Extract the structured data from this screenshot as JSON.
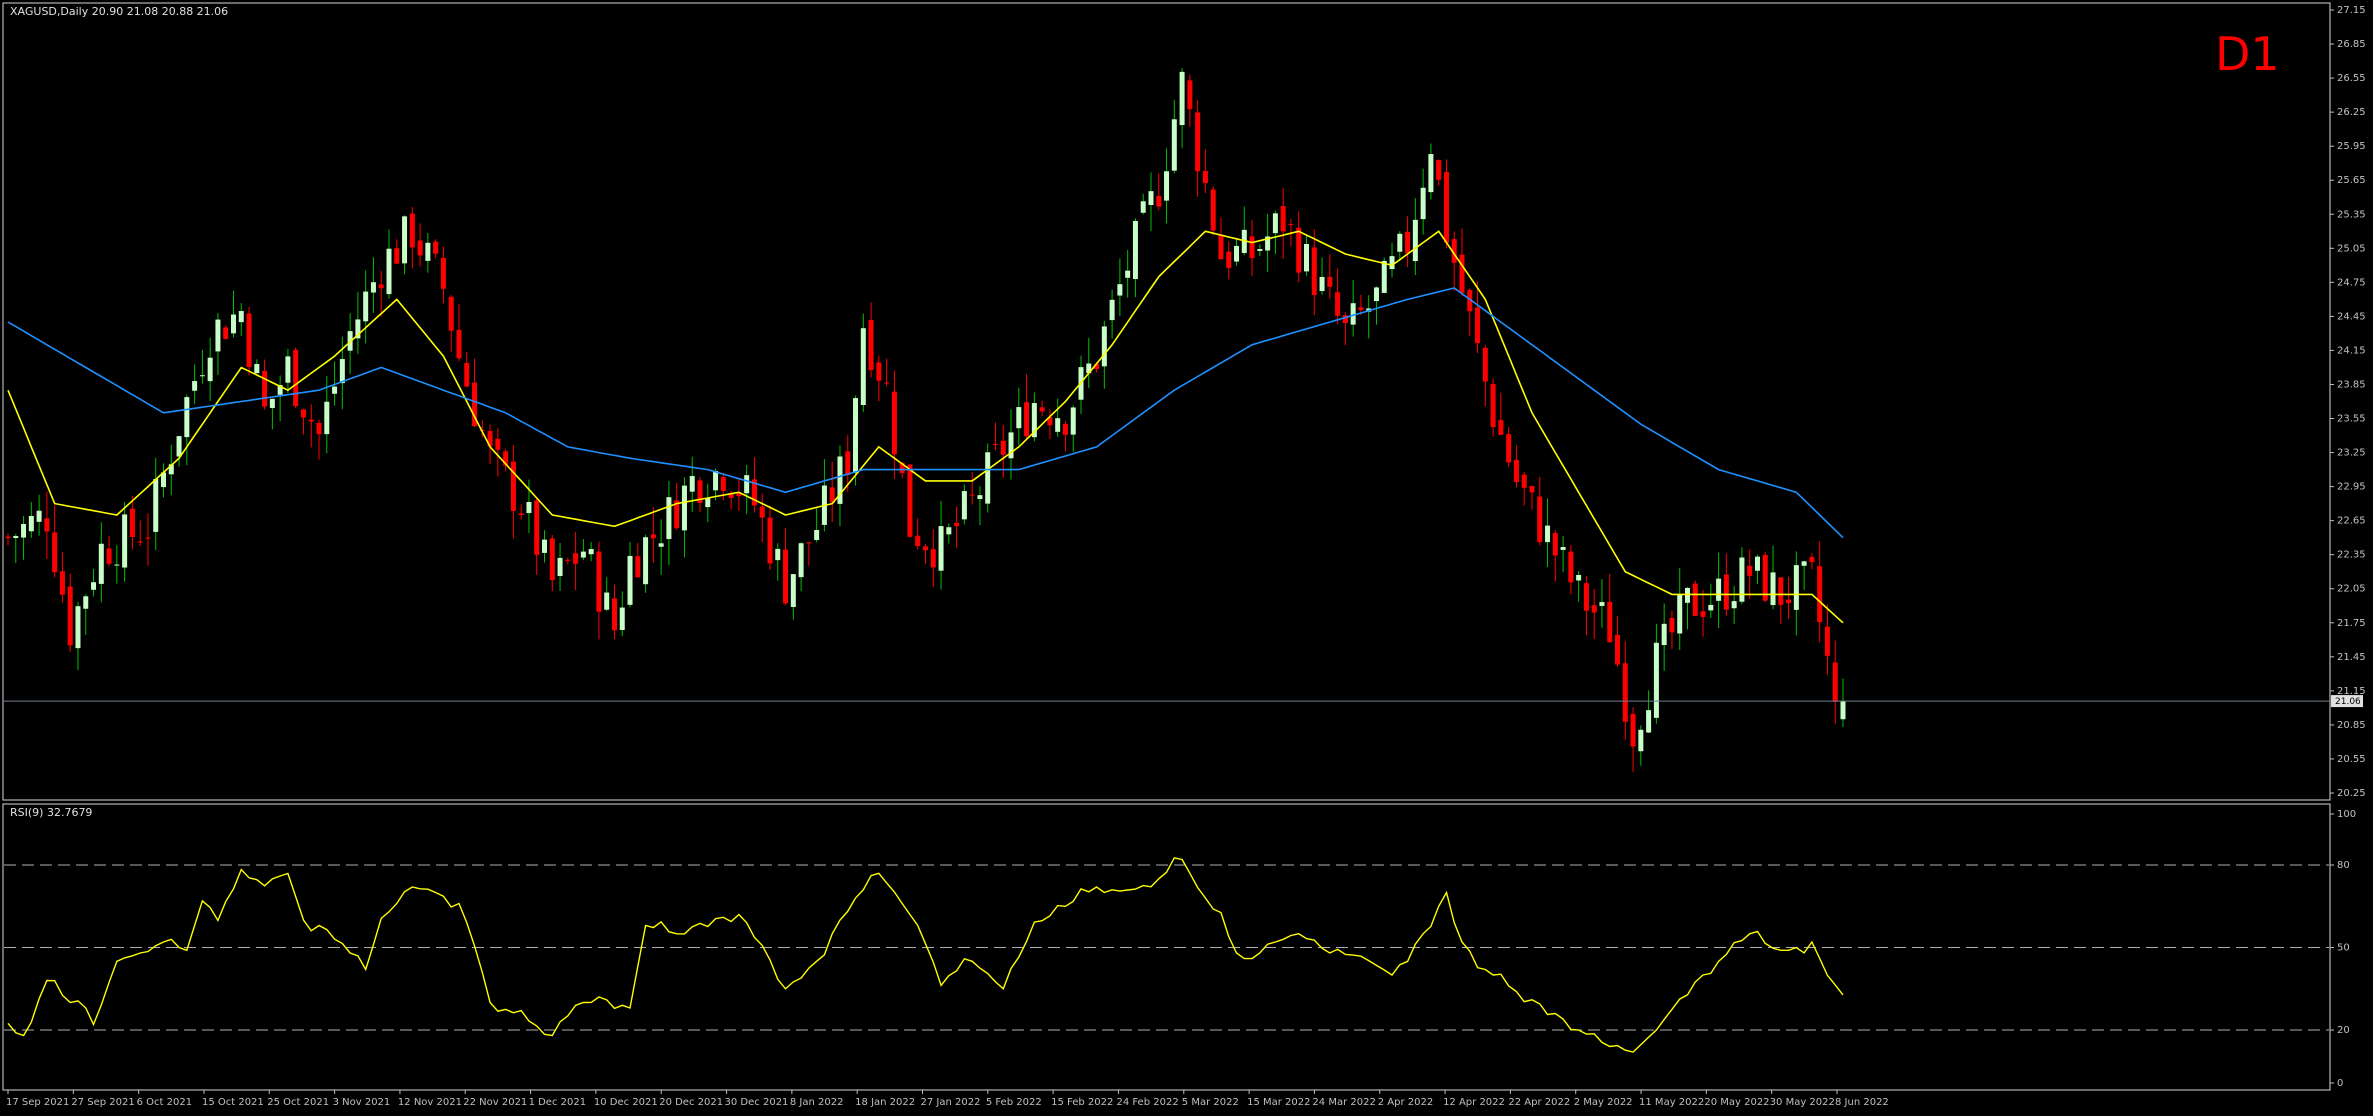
{
  "header": {
    "symbol_line": "XAGUSD,Daily  20.90 21.08 20.88 21.06",
    "timeframe_badge": "D1",
    "current_price": "21.06"
  },
  "rsi_panel": {
    "label": "RSI(9) 32.7679"
  },
  "colors": {
    "background": "#000000",
    "bull_candle": "#c8ffc8",
    "bear_candle": "#ff0000",
    "wick_bull": "#00c000",
    "wick_bear": "#ff0000",
    "ma_fast": "#ffff00",
    "ma_slow": "#1e90ff",
    "rsi_line": "#ffff00",
    "price_line": "#708090",
    "grid_text": "#c0c0c0"
  },
  "chart_data": [
    {
      "type": "candlestick",
      "title": "XAGUSD,Daily",
      "ylim": [
        20.25,
        27.15
      ],
      "y_ticks": [
        "27.15",
        "26.85",
        "26.55",
        "26.25",
        "25.95",
        "25.65",
        "25.35",
        "25.05",
        "24.75",
        "24.45",
        "24.15",
        "23.85",
        "23.55",
        "23.25",
        "22.95",
        "22.65",
        "22.35",
        "22.05",
        "21.75",
        "21.45",
        "21.15",
        "20.85",
        "20.55",
        "20.25"
      ],
      "x_ticks": [
        "17 Sep 2021",
        "27 Sep 2021",
        "6 Oct 2021",
        "15 Oct 2021",
        "25 Oct 2021",
        "3 Nov 2021",
        "12 Nov 2021",
        "22 Nov 2021",
        "1 Dec 2021",
        "10 Dec 2021",
        "20 Dec 2021",
        "30 Dec 2021",
        "8 Jan 2022",
        "18 Jan 2022",
        "27 Jan 2022",
        "5 Feb 2022",
        "15 Feb 2022",
        "24 Feb 2022",
        "5 Mar 2022",
        "15 Mar 2022",
        "24 Mar 2022",
        "2 Apr 2022",
        "12 Apr 2022",
        "22 Apr 2022",
        "2 May 2022",
        "11 May 2022",
        "20 May 2022",
        "30 May 2022",
        "8 Jun 2022"
      ],
      "anchors": [
        [
          0,
          22.5
        ],
        [
          5,
          22.7
        ],
        [
          8,
          21.7
        ],
        [
          12,
          22.4
        ],
        [
          18,
          22.6
        ],
        [
          22,
          23.5
        ],
        [
          26,
          24.3
        ],
        [
          30,
          24.5
        ],
        [
          33,
          23.6
        ],
        [
          36,
          24.0
        ],
        [
          40,
          23.4
        ],
        [
          44,
          24.3
        ],
        [
          48,
          24.9
        ],
        [
          52,
          25.2
        ],
        [
          56,
          24.7
        ],
        [
          58,
          24.1
        ],
        [
          62,
          23.2
        ],
        [
          66,
          22.8
        ],
        [
          70,
          22.1
        ],
        [
          74,
          22.4
        ],
        [
          78,
          21.7
        ],
        [
          80,
          22.3
        ],
        [
          84,
          22.6
        ],
        [
          88,
          23.0
        ],
        [
          92,
          23.1
        ],
        [
          96,
          22.8
        ],
        [
          100,
          22.1
        ],
        [
          104,
          22.6
        ],
        [
          108,
          23.2
        ],
        [
          110,
          24.4
        ],
        [
          113,
          23.8
        ],
        [
          116,
          22.6
        ],
        [
          120,
          22.4
        ],
        [
          124,
          22.8
        ],
        [
          128,
          23.3
        ],
        [
          132,
          23.7
        ],
        [
          136,
          23.6
        ],
        [
          140,
          24.1
        ],
        [
          144,
          24.9
        ],
        [
          148,
          25.6
        ],
        [
          151,
          26.5
        ],
        [
          153,
          25.9
        ],
        [
          156,
          25.0
        ],
        [
          160,
          25.0
        ],
        [
          164,
          25.3
        ],
        [
          168,
          24.8
        ],
        [
          172,
          24.3
        ],
        [
          176,
          24.6
        ],
        [
          180,
          25.1
        ],
        [
          183,
          26.0
        ],
        [
          185,
          25.2
        ],
        [
          188,
          24.4
        ],
        [
          191,
          23.6
        ],
        [
          194,
          23.0
        ],
        [
          198,
          22.5
        ],
        [
          202,
          22.0
        ],
        [
          206,
          21.7
        ],
        [
          209,
          20.8
        ],
        [
          212,
          21.4
        ],
        [
          216,
          21.9
        ],
        [
          220,
          22.0
        ],
        [
          224,
          22.2
        ],
        [
          228,
          22.0
        ],
        [
          232,
          22.1
        ],
        [
          234,
          21.4
        ],
        [
          235,
          20.95
        ],
        [
          236,
          21.06
        ]
      ],
      "series": [
        {
          "name": "fast_ma",
          "values": [
            [
              0,
              23.8
            ],
            [
              6,
              22.8
            ],
            [
              14,
              22.7
            ],
            [
              22,
              23.2
            ],
            [
              30,
              24.0
            ],
            [
              36,
              23.8
            ],
            [
              42,
              24.1
            ],
            [
              50,
              24.6
            ],
            [
              56,
              24.1
            ],
            [
              62,
              23.3
            ],
            [
              70,
              22.7
            ],
            [
              78,
              22.6
            ],
            [
              86,
              22.8
            ],
            [
              94,
              22.9
            ],
            [
              100,
              22.7
            ],
            [
              106,
              22.8
            ],
            [
              112,
              23.3
            ],
            [
              118,
              23.0
            ],
            [
              124,
              23.0
            ],
            [
              130,
              23.3
            ],
            [
              136,
              23.7
            ],
            [
              142,
              24.2
            ],
            [
              148,
              24.8
            ],
            [
              154,
              25.2
            ],
            [
              160,
              25.1
            ],
            [
              166,
              25.2
            ],
            [
              172,
              25.0
            ],
            [
              178,
              24.9
            ],
            [
              184,
              25.2
            ],
            [
              190,
              24.6
            ],
            [
              196,
              23.6
            ],
            [
              202,
              22.9
            ],
            [
              208,
              22.2
            ],
            [
              214,
              22.0
            ],
            [
              220,
              22.0
            ],
            [
              226,
              22.0
            ],
            [
              232,
              22.0
            ],
            [
              236,
              21.75
            ]
          ]
        },
        {
          "name": "slow_ma",
          "values": [
            [
              0,
              24.4
            ],
            [
              10,
              24.0
            ],
            [
              20,
              23.6
            ],
            [
              30,
              23.7
            ],
            [
              40,
              23.8
            ],
            [
              48,
              24.0
            ],
            [
              56,
              23.8
            ],
            [
              64,
              23.6
            ],
            [
              72,
              23.3
            ],
            [
              80,
              23.2
            ],
            [
              90,
              23.1
            ],
            [
              100,
              22.9
            ],
            [
              110,
              23.1
            ],
            [
              120,
              23.1
            ],
            [
              130,
              23.1
            ],
            [
              140,
              23.3
            ],
            [
              150,
              23.8
            ],
            [
              160,
              24.2
            ],
            [
              170,
              24.4
            ],
            [
              180,
              24.6
            ],
            [
              186,
              24.7
            ],
            [
              194,
              24.3
            ],
            [
              202,
              23.9
            ],
            [
              210,
              23.5
            ],
            [
              220,
              23.1
            ],
            [
              230,
              22.9
            ],
            [
              236,
              22.5
            ]
          ]
        }
      ]
    },
    {
      "type": "line",
      "title": "RSI(9) 32.7679",
      "ylim": [
        0,
        100
      ],
      "y_ticks": [
        "100",
        "80",
        "50",
        "20",
        "0"
      ],
      "levels": [
        80,
        50,
        20
      ],
      "series": [
        {
          "name": "RSI(9)",
          "values": [
            [
              0,
              20
            ],
            [
              2,
              18
            ],
            [
              5,
              38
            ],
            [
              8,
              30
            ],
            [
              10,
              28
            ],
            [
              11,
              22
            ],
            [
              14,
              45
            ],
            [
              17,
              48
            ],
            [
              20,
              52
            ],
            [
              23,
              49
            ],
            [
              25,
              67
            ],
            [
              27,
              62
            ],
            [
              30,
              76
            ],
            [
              33,
              74
            ],
            [
              36,
              77
            ],
            [
              38,
              60
            ],
            [
              40,
              58
            ],
            [
              42,
              55
            ],
            [
              44,
              48
            ],
            [
              46,
              42
            ],
            [
              48,
              60
            ],
            [
              52,
              72
            ],
            [
              55,
              70
            ],
            [
              58,
              66
            ],
            [
              60,
              52
            ],
            [
              62,
              30
            ],
            [
              66,
              25
            ],
            [
              70,
              18
            ],
            [
              72,
              28
            ],
            [
              76,
              32
            ],
            [
              80,
              28
            ],
            [
              82,
              58
            ],
            [
              86,
              55
            ],
            [
              90,
              60
            ],
            [
              94,
              62
            ],
            [
              96,
              56
            ],
            [
              100,
              35
            ],
            [
              104,
              45
            ],
            [
              108,
              65
            ],
            [
              112,
              77
            ],
            [
              114,
              70
            ],
            [
              117,
              58
            ],
            [
              120,
              38
            ],
            [
              124,
              45
            ],
            [
              128,
              35
            ],
            [
              132,
              58
            ],
            [
              136,
              65
            ],
            [
              140,
              72
            ],
            [
              144,
              70
            ],
            [
              148,
              75
            ],
            [
              151,
              82
            ],
            [
              153,
              72
            ],
            [
              156,
              60
            ],
            [
              158,
              48
            ],
            [
              160,
              46
            ],
            [
              163,
              52
            ],
            [
              166,
              55
            ],
            [
              170,
              48
            ],
            [
              174,
              47
            ],
            [
              178,
              40
            ],
            [
              182,
              55
            ],
            [
              185,
              70
            ],
            [
              187,
              52
            ],
            [
              190,
              42
            ],
            [
              194,
              34
            ],
            [
              198,
              28
            ],
            [
              202,
              20
            ],
            [
              206,
              14
            ],
            [
              209,
              12
            ],
            [
              212,
              20
            ],
            [
              216,
              35
            ],
            [
              220,
              45
            ],
            [
              224,
              55
            ],
            [
              228,
              48
            ],
            [
              232,
              52
            ],
            [
              234,
              40
            ],
            [
              236,
              32.77
            ]
          ]
        }
      ]
    }
  ]
}
